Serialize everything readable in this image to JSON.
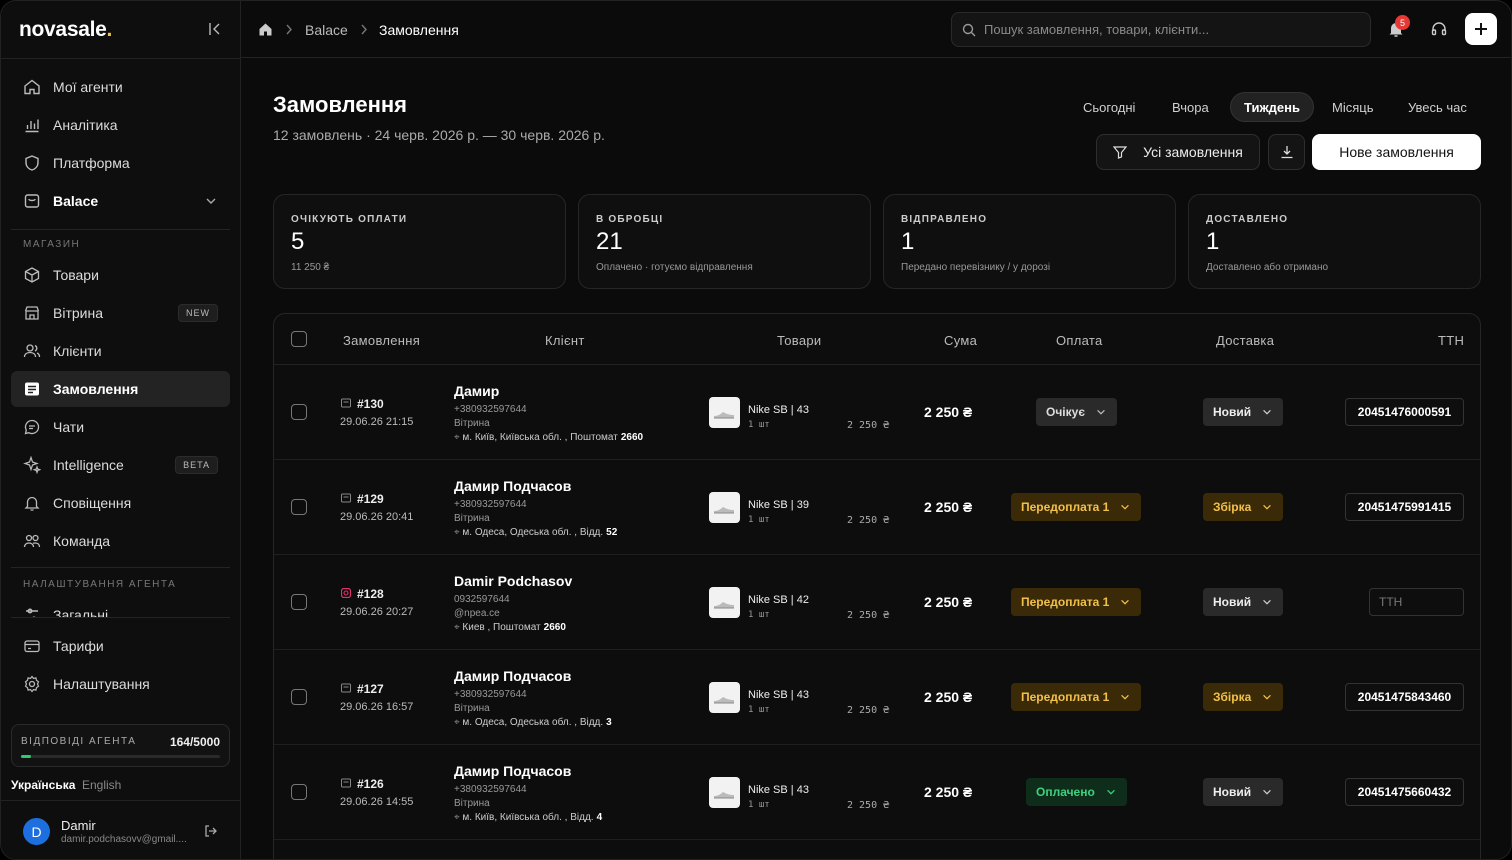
{
  "app": {
    "logo": "novasale",
    "logo_dot": "."
  },
  "sidebar": {
    "items_top": [
      {
        "label": "Мої агенти",
        "icon": "home-icon"
      },
      {
        "label": "Аналітика",
        "icon": "chart-icon"
      },
      {
        "label": "Платформа",
        "icon": "shield-icon"
      },
      {
        "label": "Balace",
        "icon": "store-icon"
      }
    ],
    "section_shop": "МАГАЗИН",
    "items_shop": [
      {
        "label": "Товари",
        "icon": "box-icon"
      },
      {
        "label": "Вітрина",
        "icon": "storefront-icon",
        "badge": "NEW"
      },
      {
        "label": "Клієнти",
        "icon": "users-icon"
      },
      {
        "label": "Замовлення",
        "icon": "orders-icon"
      },
      {
        "label": "Чати",
        "icon": "chat-icon"
      },
      {
        "label": "Intelligence",
        "icon": "sparkle-icon",
        "badge": "BETA"
      },
      {
        "label": "Сповіщення",
        "icon": "bell-icon"
      },
      {
        "label": "Команда",
        "icon": "team-icon"
      }
    ],
    "section_agent": "НАЛАШТУВАННЯ АГЕНТА",
    "partial_item": "Загальні",
    "items_bottom": [
      {
        "label": "Тарифи",
        "icon": "card-icon"
      },
      {
        "label": "Налаштування",
        "icon": "gear-icon"
      }
    ],
    "quota": {
      "label": "ВІДПОВІДІ АГЕНТА",
      "value": "164/5000",
      "used": 164,
      "total": 5000
    },
    "languages": [
      "Українська",
      "English"
    ],
    "user": {
      "initial": "D",
      "name": "Damir",
      "email": "damir.podchasovv@gmail...."
    }
  },
  "topbar": {
    "breadcrumbs": [
      "Balace",
      "Замовлення"
    ],
    "search_placeholder": "Пошук замовлення, товари, клієнти...",
    "notifications": "5"
  },
  "page": {
    "title": "Замовлення",
    "subtitle": "12 замовлень · 24 черв. 2026 р. — 30 черв. 2026 р.",
    "periods": [
      "Сьогодні",
      "Вчора",
      "Тиждень",
      "Місяць",
      "Увесь час"
    ],
    "filter_label": "Усі замовлення",
    "new_order_label": "Нове замовлення"
  },
  "stats": [
    {
      "label": "ОЧІКУЮТЬ ОПЛАТИ",
      "value": "5",
      "sub": "11 250 ₴"
    },
    {
      "label": "В ОБРОБЦІ",
      "value": "21",
      "sub": "Оплачено · готуємо відправлення"
    },
    {
      "label": "ВІДПРАВЛЕНО",
      "value": "1",
      "sub": "Передано перевізнику / у дорозі"
    },
    {
      "label": "ДОСТАВЛЕНО",
      "value": "1",
      "sub": "Доставлено або отримано"
    }
  ],
  "table": {
    "headers": [
      "Замовлення",
      "Клієнт",
      "Товари",
      "Сума",
      "Оплата",
      "Доставка",
      "ТТН"
    ],
    "ttn_placeholder": "ТТН",
    "rows": [
      {
        "id": "#130",
        "source": "storefront-icon",
        "date": "29.06.26 21:15",
        "name": "Дамир",
        "phone": "+380932597644",
        "channel": "Вітрина",
        "address": "м. Київ, Київська обл. , Поштомат",
        "address_num": "2660",
        "product": "Nike SB | 43",
        "qty": "1 шт",
        "price": "2 250 ₴",
        "sum": "2 250 ₴",
        "payment": "Очікує",
        "payment_style": "gray",
        "delivery": "Новий",
        "delivery_style": "dark",
        "ttn": "20451476000591"
      },
      {
        "id": "#129",
        "source": "storefront-icon",
        "date": "29.06.26 20:41",
        "name": "Дамир Подчасов",
        "phone": "+380932597644",
        "channel": "Вітрина",
        "address": "м. Одеса, Одеська обл. , Відд.",
        "address_num": "52",
        "product": "Nike SB | 39",
        "qty": "1 шт",
        "price": "2 250 ₴",
        "sum": "2 250 ₴",
        "payment": "Передоплата 1",
        "payment_style": "amber",
        "delivery": "Збірка",
        "delivery_style": "amber",
        "ttn": "20451475991415"
      },
      {
        "id": "#128",
        "source": "instagram-icon",
        "date": "29.06.26 20:27",
        "name": "Damir Podchasov",
        "phone": "0932597644",
        "channel": "@npea.ce",
        "address": "Киев , Поштомат",
        "address_num": "2660",
        "product": "Nike SB | 42",
        "qty": "1 шт",
        "price": "2 250 ₴",
        "sum": "2 250 ₴",
        "payment": "Передоплата 1",
        "payment_style": "amber",
        "delivery": "Новий",
        "delivery_style": "dark",
        "ttn": ""
      },
      {
        "id": "#127",
        "source": "storefront-icon",
        "date": "29.06.26 16:57",
        "name": "Дамир Подчасов",
        "phone": "+380932597644",
        "channel": "Вітрина",
        "address": "м. Одеса, Одеська обл. , Відд.",
        "address_num": "3",
        "product": "Nike SB | 43",
        "qty": "1 шт",
        "price": "2 250 ₴",
        "sum": "2 250 ₴",
        "payment": "Передоплата 1",
        "payment_style": "amber",
        "delivery": "Збірка",
        "delivery_style": "amber",
        "ttn": "20451475843460"
      },
      {
        "id": "#126",
        "source": "storefront-icon",
        "date": "29.06.26 14:55",
        "name": "Дамир Подчасов",
        "phone": "+380932597644",
        "channel": "Вітрина",
        "address": "м. Київ, Київська обл. , Відд.",
        "address_num": "4",
        "product": "Nike SB | 43",
        "qty": "1 шт",
        "price": "2 250 ₴",
        "sum": "2 250 ₴",
        "payment": "Оплачено",
        "payment_style": "green",
        "delivery": "Новий",
        "delivery_style": "dark",
        "ttn": "20451475660432"
      }
    ]
  }
}
